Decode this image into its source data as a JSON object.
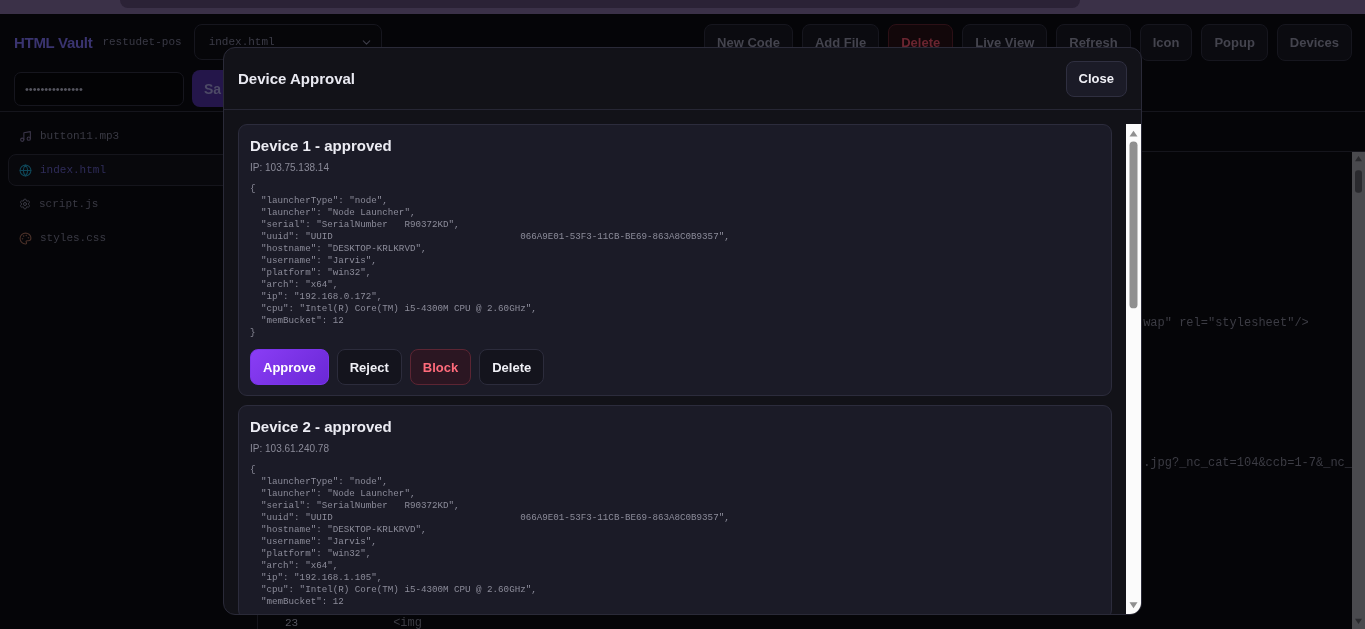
{
  "app": {
    "title": "HTML Vault",
    "project": "restudet-pos",
    "file_select": "index.html",
    "toolbar": [
      {
        "label": "New Code",
        "kind": "default"
      },
      {
        "label": "Add File",
        "kind": "default"
      },
      {
        "label": "Delete",
        "kind": "danger"
      },
      {
        "label": "Live View",
        "kind": "default"
      },
      {
        "label": "Refresh",
        "kind": "default"
      },
      {
        "label": "Icon",
        "kind": "default"
      },
      {
        "label": "Popup",
        "kind": "default"
      },
      {
        "label": "Devices",
        "kind": "default"
      }
    ],
    "password": {
      "value": "•••••••••••••••"
    },
    "save_button": "Sa"
  },
  "files": [
    {
      "name": "button11.mp3",
      "selected": false
    },
    {
      "name": "index.html",
      "selected": true
    },
    {
      "name": "script.js",
      "selected": false
    },
    {
      "name": "styles.css",
      "selected": false
    }
  ],
  "code_lines": [
    {
      "kind": "fragment",
      "text": "wap\" rel=\"stylesheet\"/>"
    },
    {
      "kind": "fragment",
      "text": ".jpg?_nc_cat=104&ccb=1-7&_nc_"
    },
    {
      "kind": "line",
      "number": "23",
      "text": "<img"
    }
  ],
  "modal": {
    "title": "Device Approval",
    "close": "Close",
    "devices": [
      {
        "title": "Device 1 - approved",
        "ip": "IP: 103.75.138.14",
        "details": "{\n  \"launcherType\": \"node\",\n  \"launcher\": \"Node Launcher\",\n  \"serial\": \"SerialNumber   R90372KD\",\n  \"uuid\": \"UUID                                  066A9E01-53F3-11CB-BE69-863A8C0B9357\",\n  \"hostname\": \"DESKTOP-KRLKRVD\",\n  \"username\": \"Jarvis\",\n  \"platform\": \"win32\",\n  \"arch\": \"x64\",\n  \"ip\": \"192.168.0.172\",\n  \"cpu\": \"Intel(R) Core(TM) i5-4300M CPU @ 2.60GHz\",\n  \"memBucket\": 12\n}",
        "actions": [
          {
            "label": "Approve",
            "kind": "primary"
          },
          {
            "label": "Reject",
            "kind": "default"
          },
          {
            "label": "Block",
            "kind": "danger"
          },
          {
            "label": "Delete",
            "kind": "default"
          }
        ]
      },
      {
        "title": "Device 2 - approved",
        "ip": "IP: 103.61.240.78",
        "details": "{\n  \"launcherType\": \"node\",\n  \"launcher\": \"Node Launcher\",\n  \"serial\": \"SerialNumber   R90372KD\",\n  \"uuid\": \"UUID                                  066A9E01-53F3-11CB-BE69-863A8C0B9357\",\n  \"hostname\": \"DESKTOP-KRLKRVD\",\n  \"username\": \"Jarvis\",\n  \"platform\": \"win32\",\n  \"arch\": \"x64\",\n  \"ip\": \"192.168.1.105\",\n  \"cpu\": \"Intel(R) Core(TM) i5-4300M CPU @ 2.60GHz\",\n  \"memBucket\": 12"
      }
    ]
  }
}
